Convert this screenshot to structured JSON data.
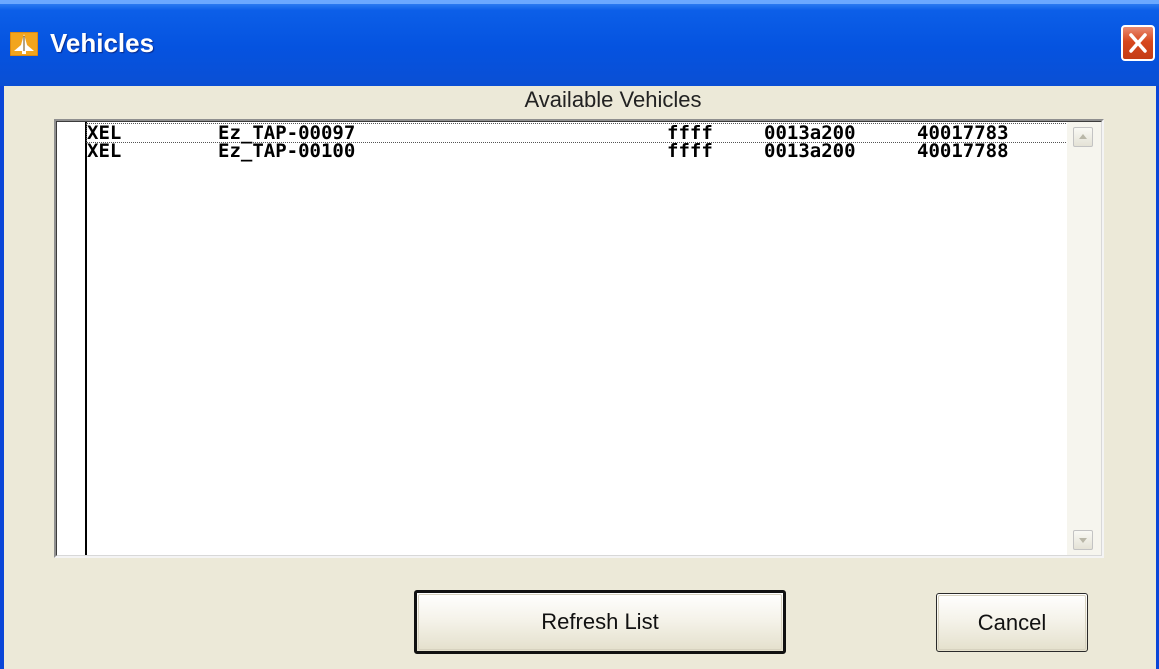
{
  "window": {
    "title": "Vehicles"
  },
  "list": {
    "title": "Available Vehicles",
    "rows": [
      {
        "type": "XEL",
        "name": "Ez_TAP-00097",
        "pan": "ffff",
        "addr_high": "0013a200",
        "addr_low": "40017783"
      },
      {
        "type": "XEL",
        "name": "Ez_TAP-00100",
        "pan": "ffff",
        "addr_high": "0013a200",
        "addr_low": "40017788"
      }
    ]
  },
  "buttons": {
    "refresh_label": "Refresh List",
    "cancel_label": "Cancel"
  },
  "icons": {
    "app": "vehicle-icon",
    "close": "close-icon",
    "scroll_up": "scroll-up-arrow-icon",
    "scroll_down": "scroll-down-arrow-icon"
  },
  "colors": {
    "titlebar": "#0553e0",
    "close_button": "#d7481e",
    "dialog_face": "#ece9d8"
  }
}
